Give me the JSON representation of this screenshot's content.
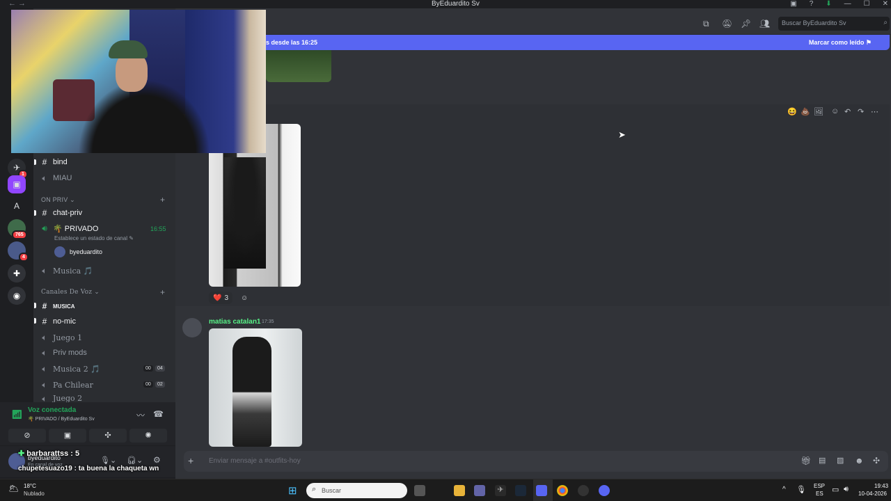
{
  "window": {
    "title": "ByEduardito Sv",
    "controls": [
      "—",
      "☐",
      "✕"
    ]
  },
  "rail": {
    "letter_server": "A",
    "badges": {
      "server_a": "1",
      "server_b": "765",
      "server_c": "4"
    }
  },
  "sidebar": {
    "channels_top": [
      {
        "name": "bind",
        "type": "text"
      },
      {
        "name": "MIAU",
        "type": "voice"
      }
    ],
    "category_priv": "ON PRIV",
    "priv_channels": {
      "chat": "chat-priv",
      "voice_name": "🌴 PRIVADO",
      "voice_time": "16:55",
      "voice_status": "Establece un estado de canal",
      "user": "byeduardito",
      "musica": "Musica 🎵"
    },
    "category_voz": "Canales De Voz",
    "voz_channels": [
      {
        "name": "MUSICA",
        "type": "text"
      },
      {
        "name": "no-mic",
        "type": "text"
      },
      {
        "name": "Juego 1",
        "type": "voice"
      },
      {
        "name": "Priv mods",
        "type": "voice"
      },
      {
        "name": "Musica 2 🎵",
        "type": "voice",
        "count_a": "00",
        "count_b": "04"
      },
      {
        "name": "Pa Chilear",
        "type": "voice",
        "count_a": "00",
        "count_b": "02"
      },
      {
        "name": "Juego 2",
        "type": "voice"
      }
    ]
  },
  "voice_panel": {
    "status": "Voz conectada",
    "location": "🌴 PRIVADO / ByEduardito Sv"
  },
  "userbar": {
    "name": "byeduardito",
    "status": "En canal de voz"
  },
  "stream_chat": [
    {
      "text": "barbarattss : 5"
    },
    {
      "text": "chupetesuazo19 : ta buena la chaqueta wn"
    }
  ],
  "header": {
    "search_placeholder": "Buscar ByEduardito Sv"
  },
  "new_messages_bar": {
    "text": "s desde las 16:25",
    "action": "Marcar como leído"
  },
  "messages": [
    {
      "reaction_emoji": "❤️",
      "reaction_count": "3"
    },
    {
      "author": "matias catalan1",
      "time": "17:35"
    }
  ],
  "composer": {
    "placeholder": "Enviar mensaje a #outfits-hoy"
  },
  "taskbar": {
    "weather_temp": "18°C",
    "weather_desc": "Nublado",
    "search": "Buscar",
    "lang_top": "ESP",
    "lang_bottom": "ES",
    "clock_time": "19:43",
    "clock_date": "10-04-2026"
  },
  "colors": {
    "accent": "#5865f2",
    "online": "#23a55a",
    "author": "#57f287"
  }
}
